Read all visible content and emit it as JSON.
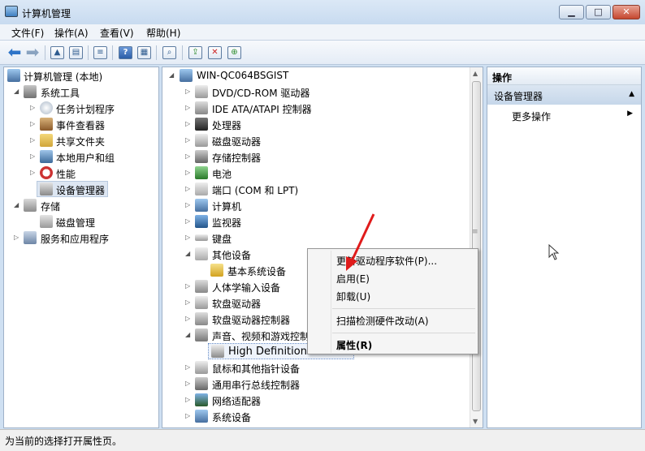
{
  "window": {
    "title": "计算机管理",
    "buttons": {
      "minimize": "▁",
      "maximize": "□",
      "close": "✕"
    }
  },
  "menu": [
    "文件(F)",
    "操作(A)",
    "查看(V)",
    "帮助(H)"
  ],
  "tree": {
    "root": "计算机管理 (本地)",
    "system_tools": "系统工具",
    "items": [
      "任务计划程序",
      "事件查看器",
      "共享文件夹",
      "本地用户和组",
      "性能",
      "设备管理器"
    ],
    "storage": "存储",
    "disk_mgmt": "磁盘管理",
    "services": "服务和应用程序"
  },
  "devices": {
    "computer": "WIN-QC064BSGIST",
    "list": [
      "DVD/CD-ROM 驱动器",
      "IDE ATA/ATAPI 控制器",
      "处理器",
      "磁盘驱动器",
      "存储控制器",
      "电池",
      "端口 (COM 和 LPT)",
      "计算机",
      "监视器",
      "键盘",
      "其他设备",
      "基本系统设备",
      "人体学输入设备",
      "软盘驱动器",
      "软盘驱动器控制器",
      "声音、视频和游戏控制",
      "High Definition A",
      "鼠标和其他指针设备",
      "通用串行总线控制器",
      "网络适配器",
      "系统设备"
    ]
  },
  "actions": {
    "header": "操作",
    "group": "设备管理器",
    "more": "更多操作"
  },
  "context_menu": {
    "update": "更新驱动程序软件(P)...",
    "enable": "启用(E)",
    "uninstall": "卸载(U)",
    "scan": "扫描检测硬件改动(A)",
    "properties": "属性(R)"
  },
  "status": "为当前的选择打开属性页。"
}
